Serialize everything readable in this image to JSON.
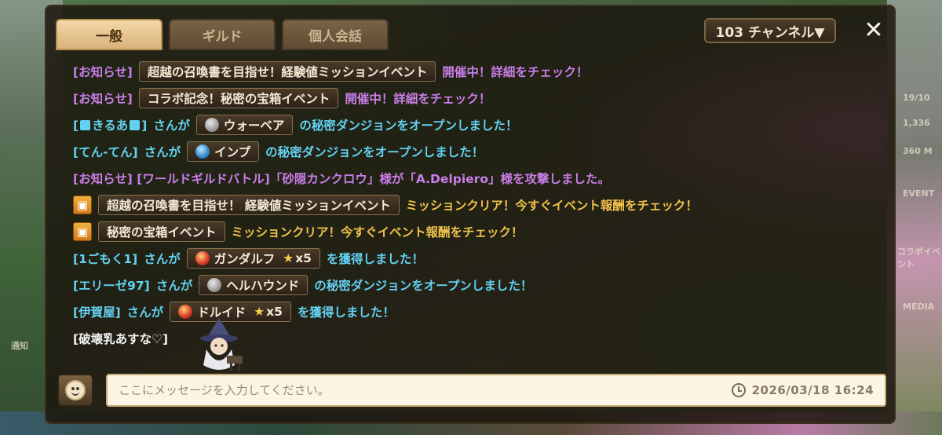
{
  "tabs": [
    {
      "label": "一般",
      "active": true
    },
    {
      "label": "ギルド",
      "active": false
    },
    {
      "label": "個人会話",
      "active": false
    }
  ],
  "channel_label": "103 チャンネル▼",
  "close_label": "✕",
  "messages": [
    {
      "type": "notice",
      "tag": "[お知らせ]",
      "item": "超越の召喚書を目指せ！経験値ミッションイベント",
      "suffix": "開催中！詳細をチェック！"
    },
    {
      "type": "notice",
      "tag": "[お知らせ]",
      "item": "コラボ記念！秘密の宝箱イベント",
      "suffix": "開催中！詳細をチェック！"
    },
    {
      "type": "dungeon",
      "user_prefix": "[",
      "user_name": "きるあ",
      "user_suffix": "]",
      "verb": "さんが",
      "item": "ウォーベア",
      "suffix": "の秘密ダンジョンをオープンしました！"
    },
    {
      "type": "dungeon",
      "user": "[てん-てん]",
      "verb": "さんが",
      "item": "インプ",
      "suffix": "の秘密ダンジョンをオープンしました！"
    },
    {
      "type": "guild",
      "text": "[お知らせ] [ワールドギルドバトル]「砂隠カンクロウ」様が「A.Delpiero」様を攻撃しました。"
    },
    {
      "type": "mission",
      "item": "超越の召喚書を目指せ！ 経験値ミッションイベント",
      "suffix": "ミッションクリア！今すぐイベント報酬をチェック！"
    },
    {
      "type": "mission",
      "item": "秘密の宝箱イベント",
      "suffix": "ミッションクリア！今すぐイベント報酬をチェック！"
    },
    {
      "type": "obtain",
      "user": "[1ごもく1]",
      "verb": "さんが",
      "item": "ガンダルフ",
      "star": "★",
      "count": "x5",
      "suffix": "を獲得しました！"
    },
    {
      "type": "dungeon",
      "user": "[エリーゼ97]",
      "verb": "さんが",
      "item": "ヘルハウンド",
      "suffix": "の秘密ダンジョンをオープンしました！"
    },
    {
      "type": "obtain",
      "user": "[伊賀屋]",
      "verb": "さんが",
      "item": "ドルイド",
      "star": "★",
      "count": "x5",
      "suffix": "を獲得しました！"
    },
    {
      "type": "chat",
      "user": "[破壊乳あすな♡]"
    }
  ],
  "input": {
    "placeholder": "ここにメッセージを入力してください。"
  },
  "timestamp": "2026/03/18  16:24",
  "background_labels": {
    "stat1": "19/10",
    "stat2": "1,336",
    "stat3": "360 M",
    "event": "EVENT",
    "collab": "コラボイベント",
    "media": "MEDIA",
    "notice": "通知"
  },
  "colors": {
    "notice_purple": "#c97ee8",
    "user_cyan": "#63d2f2",
    "mission_yellow": "#f0c24a",
    "panel_bg": "#1c160e"
  }
}
